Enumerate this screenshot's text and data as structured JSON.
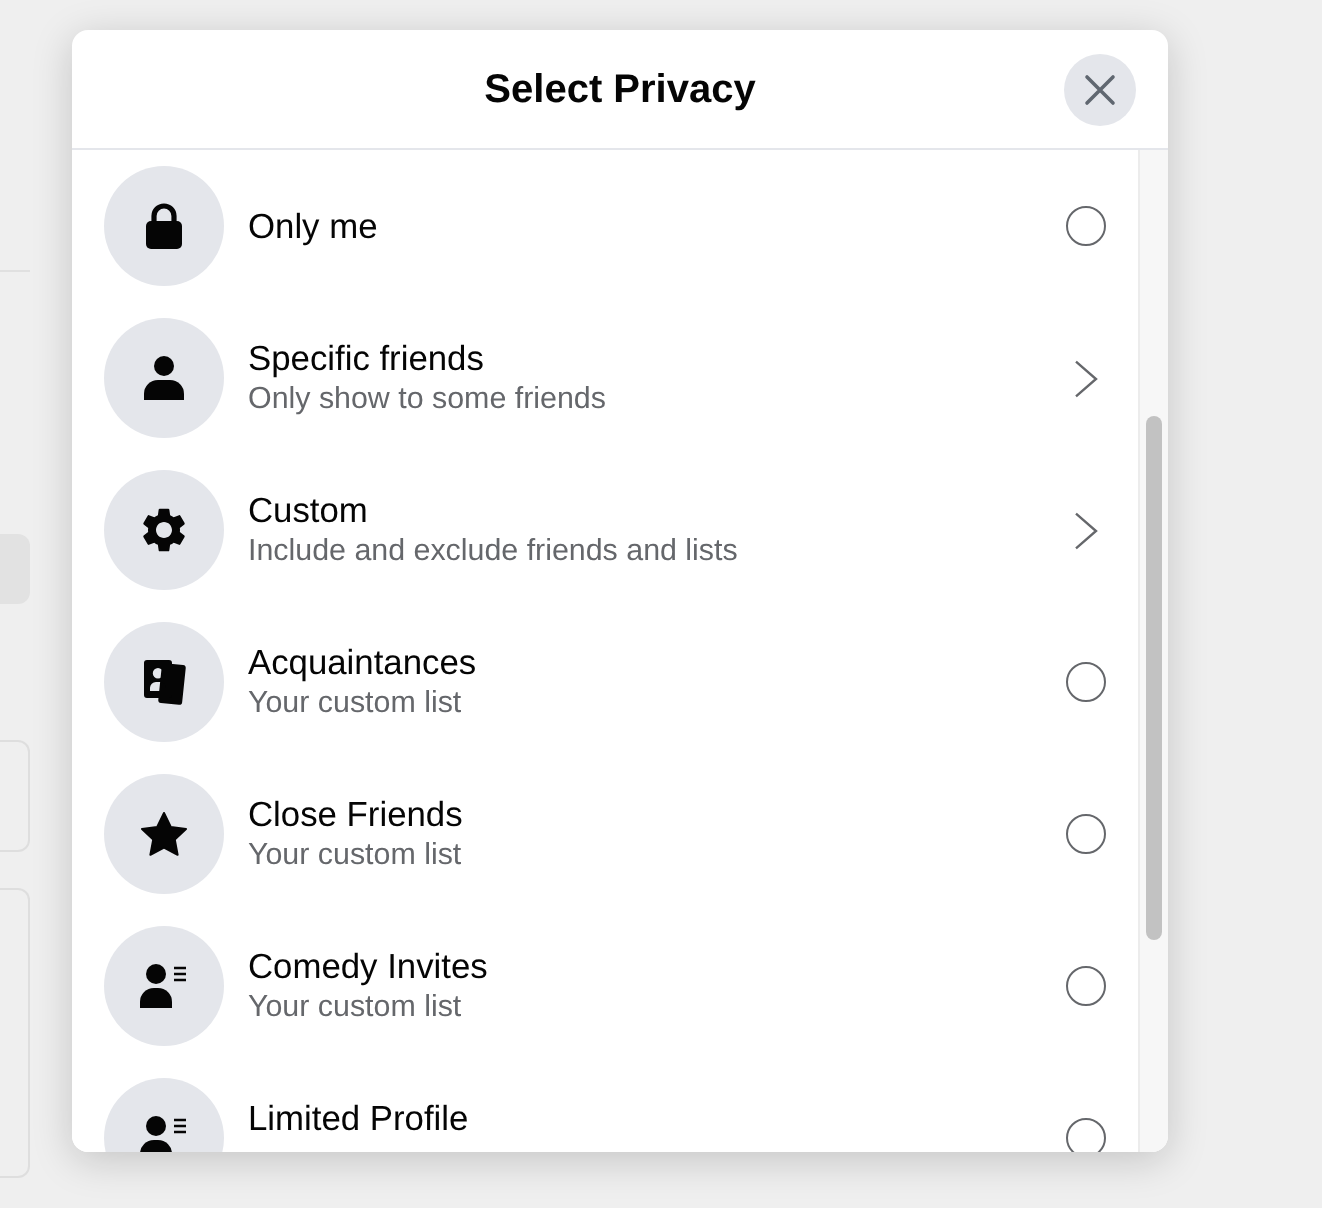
{
  "dialog": {
    "title": "Select Privacy"
  },
  "options": [
    {
      "title": "Only me",
      "kind": "radio",
      "selected": false
    },
    {
      "title": "Specific friends",
      "subtitle": "Only show to some friends",
      "kind": "submenu",
      "selected": false
    },
    {
      "title": "Custom",
      "subtitle": "Include and exclude friends and lists",
      "kind": "submenu",
      "selected": false
    },
    {
      "title": "Acquaintances",
      "subtitle": "Your custom list",
      "kind": "radio",
      "selected": false
    },
    {
      "title": "Close Friends",
      "subtitle": "Your custom list",
      "kind": "radio",
      "selected": false
    },
    {
      "title": "Comedy Invites",
      "subtitle": "Your custom list",
      "kind": "radio",
      "selected": false
    },
    {
      "title": "Limited Profile",
      "kind": "radio",
      "selected": false
    }
  ]
}
